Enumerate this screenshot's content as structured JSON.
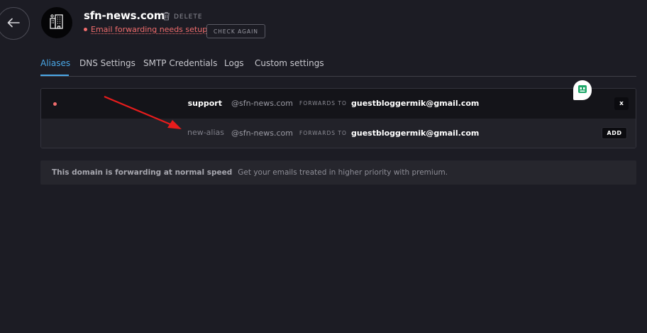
{
  "header": {
    "domain": "sfn-news.com",
    "delete_label": "DELETE",
    "status_text": "Email forwarding needs setup",
    "check_again_label": "CHECK AGAIN"
  },
  "tabs": [
    {
      "label": "Aliases",
      "active": true
    },
    {
      "label": "DNS Settings",
      "active": false
    },
    {
      "label": "SMTP Credentials",
      "active": false
    },
    {
      "label": "Logs",
      "active": false
    },
    {
      "label": "Custom settings",
      "active": false
    }
  ],
  "aliases": [
    {
      "name": "support",
      "domain": "@sfn-news.com",
      "forwards_label": "FORWARDS TO",
      "email": "guestbloggermik@gmail.com",
      "action_label": "x"
    }
  ],
  "new_alias": {
    "placeholder": "new-alias",
    "domain": "@sfn-news.com",
    "forwards_label": "FORWARDS TO",
    "email": "guestbloggermik@gmail.com",
    "add_label": "ADD"
  },
  "banner": {
    "strong": "This domain is forwarding at normal speed",
    "text": "Get your emails treated in higher priority with premium."
  },
  "colors": {
    "background": "#1c1c24",
    "accent": "#4aa8e8",
    "warning": "#f26d6d",
    "annotation_arrow": "#e81c1c"
  },
  "icons": {
    "back": "arrow-left-icon",
    "domain_logo": "buildings-icon",
    "delete": "trash-icon",
    "chat": "chat-robot-icon"
  }
}
